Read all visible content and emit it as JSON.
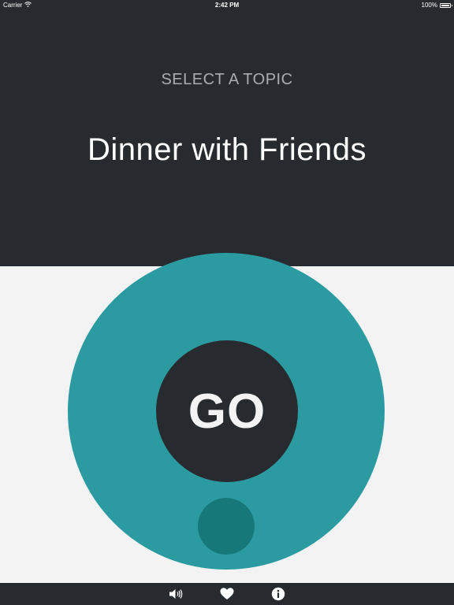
{
  "status_bar": {
    "carrier": "Carrier",
    "time": "2:42 PM",
    "battery": "100%",
    "battery_level": 1.0
  },
  "header": {
    "prompt": "SELECT A TOPIC",
    "topic": "Dinner with Friends"
  },
  "main": {
    "go_label": "GO"
  },
  "toolbar": {
    "icons": [
      "speaker-icon",
      "heart-icon",
      "info-icon"
    ]
  },
  "colors": {
    "dark": "#272b2f",
    "teal": "#2b9ba1",
    "teal_dark": "#17787a",
    "background": "#f3f3f4"
  }
}
